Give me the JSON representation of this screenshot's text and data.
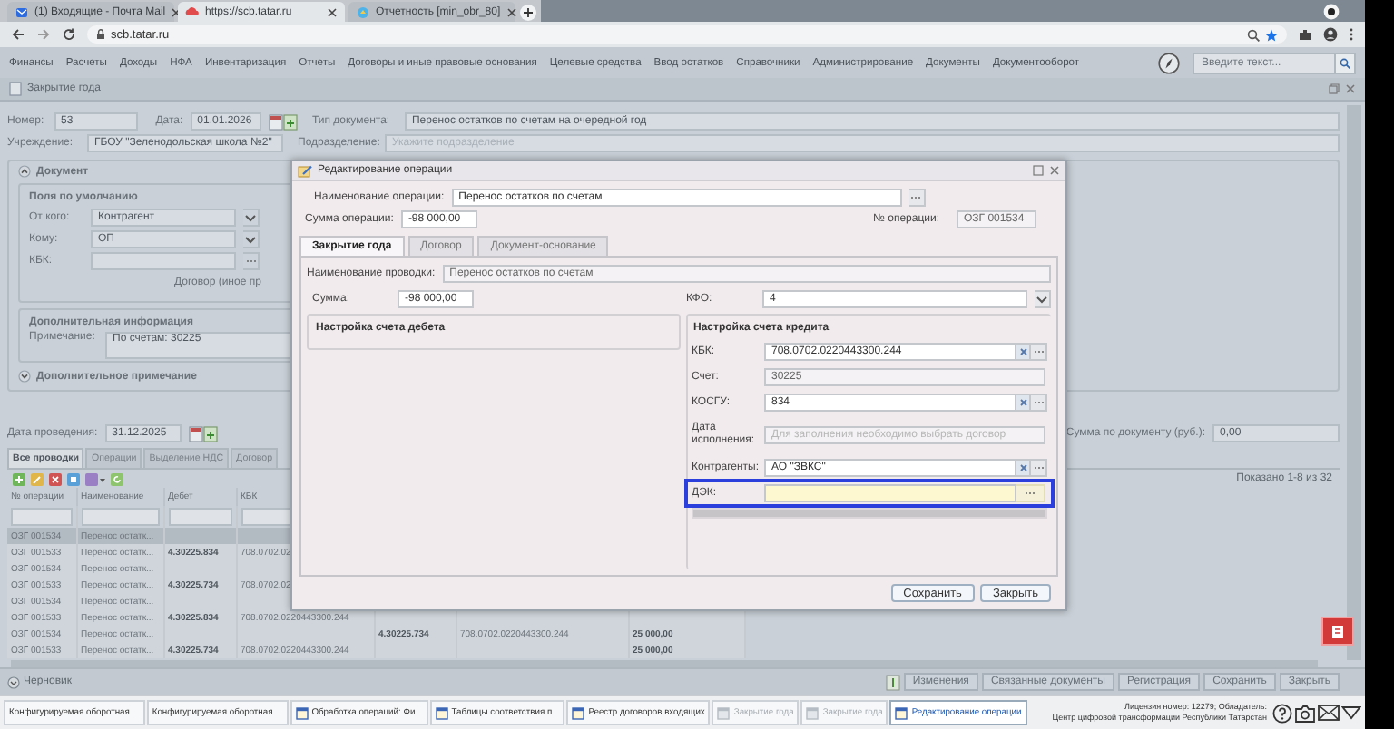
{
  "browser": {
    "tabs": [
      {
        "title": "(1) Входящие - Почта Mail",
        "selected": false
      },
      {
        "title": "https://scb.tatar.ru",
        "selected": true
      },
      {
        "title": "Отчетность [min_obr_80]",
        "selected": false
      }
    ],
    "address": "scb.tatar.ru"
  },
  "menu": [
    "Финансы",
    "Расчеты",
    "Доходы",
    "НФА",
    "Инвентаризация",
    "Отчеты",
    "Договоры и иные правовые основания",
    "Целевые средства",
    "Ввод остатков",
    "Справочники",
    "Администрирование",
    "Документы",
    "Документооборот"
  ],
  "search": {
    "placeholder": "Введите текст..."
  },
  "panel": {
    "title": "Закрытие года"
  },
  "form": {
    "number_label": "Номер:",
    "number": "53",
    "date_label": "Дата:",
    "date": "01.01.2026",
    "doc_type_label": "Тип документа:",
    "doc_type": "Перенос остатков по счетам на очередной год",
    "institution_label": "Учреждение:",
    "institution": "ГБОУ \"Зеленодольская школа №2\"",
    "division_label": "Подразделение:",
    "division_placeholder": "Укажите подразделение"
  },
  "document_section": {
    "title": "Документ",
    "expanded": true,
    "defaults_title": "Поля по умолчанию",
    "fields": [
      {
        "label": "От кого:",
        "value": "Контрагент",
        "kind": "select"
      },
      {
        "label": "Кому:",
        "value": "ОП",
        "kind": "select"
      },
      {
        "label": "КБК:",
        "kind": "lookup"
      }
    ],
    "contract_label": "Договор (иное пр",
    "extra_title": "Дополнительная информация",
    "note_label": "Примечание:",
    "note": "По счетам: 30225"
  },
  "extra_note": {
    "title": "Дополнительное примечание",
    "expanded": false
  },
  "posting_date": {
    "label": "Дата проведения:",
    "value": "31.12.2025"
  },
  "doc_sum": {
    "label": "Сумма по документу (руб.):",
    "value": "0,00"
  },
  "tabs": [
    {
      "label": "Все проводки",
      "selected": true
    },
    {
      "label": "Операции",
      "selected": false
    },
    {
      "label": "Выделение НДС",
      "selected": false
    },
    {
      "label": "Договор",
      "selected": false
    }
  ],
  "pager": "Показано 1-8 из 32",
  "table": {
    "columns": [
      "№ операции",
      "Наименование",
      "Дебет",
      "КБК"
    ],
    "rows": [
      {
        "op": "ОЗГ 001534",
        "name": "Перенос остатк...",
        "selected": true
      },
      {
        "op": "ОЗГ 001533",
        "name": "Перенос остатк...",
        "debit": "4.30225.834",
        "kbk": "708.0702.02",
        "selected": false
      },
      {
        "op": "ОЗГ 001534",
        "name": "Перенос остатк...",
        "selected": false
      },
      {
        "op": "ОЗГ 001533",
        "name": "Перенос остатк...",
        "debit": "4.30225.734",
        "kbk": "708.0702.02",
        "selected": false
      },
      {
        "op": "ОЗГ 001534",
        "name": "Перенос остатк...",
        "selected": false
      },
      {
        "op": "ОЗГ 001533",
        "name": "Перенос остатк...",
        "debit": "4.30225.834",
        "kbk": "708.0702.0220443300.244",
        "selected": false
      },
      {
        "op": "ОЗГ 001534",
        "name": "Перенос остатк...",
        "column_5": "4.30225.734",
        "column_6": "708.0702.0220443300.244",
        "column_7": "25 000,00",
        "selected": false
      },
      {
        "op": "ОЗГ 001533",
        "name": "Перенос остатк...",
        "debit": "4.30225.734",
        "kbk": "708.0702.0220443300.244",
        "column_7": "25 000,00",
        "selected": false
      }
    ]
  },
  "dialog": {
    "title": "Редактирование операции",
    "op_name_label": "Наименование операции:",
    "op_name": "Перенос остатков по счетам",
    "op_sum_label": "Сумма операции:",
    "op_sum": "-98 000,00",
    "op_no_label": "№ операции:",
    "op_no": "ОЗГ 001534",
    "tabs": [
      {
        "label": "Закрытие года",
        "selected": true
      },
      {
        "label": "Договор",
        "selected": false
      },
      {
        "label": "Документ-основание",
        "selected": false
      }
    ],
    "posting_name_label": "Наименование проводки:",
    "posting_name": "Перенос остатков по счетам",
    "sum_label": "Сумма:",
    "sum": "-98 000,00",
    "kfo_label": "КФО:",
    "kfo": "4",
    "debit_title": "Настройка счета дебета",
    "credit_title": "Настройка счета кредита",
    "credit_fields": [
      {
        "label": "КБК:",
        "value": "708.0702.0220443300.244",
        "kind": "lookup",
        "highlighted": false
      },
      {
        "label": "Счет:",
        "value": "30225",
        "kind": "readonly",
        "highlighted": false
      },
      {
        "label": "КОСГУ:",
        "value": "834",
        "kind": "lookup",
        "highlighted": false
      },
      {
        "label": "Дата исполнения:",
        "placeholder": "Для заполнения необходимо выбрать договор",
        "kind": "readonly",
        "highlighted": false
      },
      {
        "label": "Контрагенты:",
        "value": "АО \"ЗВКС\"",
        "kind": "lookup",
        "highlighted": false
      },
      {
        "label": "ДЭК:",
        "kind": "picker",
        "highlighted": true
      }
    ],
    "buttons": [
      "Сохранить",
      "Закрыть"
    ]
  },
  "status": "Черновик",
  "actions": [
    "Изменения",
    "Связанные документы",
    "Регистрация",
    "Сохранить",
    "Закрыть"
  ],
  "taskbar": [
    {
      "title": "Конфигурируемая оборотная ...",
      "kind": "plain",
      "selected": false,
      "disabled": false
    },
    {
      "title": "Конфигурируемая оборотная ...",
      "kind": "plain",
      "selected": false,
      "disabled": false
    },
    {
      "title": "Обработка операций: Фи...",
      "kind": "window",
      "selected": false,
      "disabled": false
    },
    {
      "title": "Таблицы соответствия п...",
      "kind": "window",
      "selected": false,
      "disabled": false
    },
    {
      "title": "Реестр договоров входящих",
      "kind": "window",
      "selected": false,
      "disabled": false
    },
    {
      "title": "Закрытие года",
      "kind": "window",
      "selected": false,
      "disabled": true
    },
    {
      "title": "Закрытие года",
      "kind": "window",
      "selected": false,
      "disabled": true
    },
    {
      "title": "Редактирование операции",
      "kind": "window",
      "selected": true,
      "disabled": false
    }
  ],
  "license": [
    "Лицензия номер: 12279; Обладатель:",
    "Центр цифровой трансформации Республики Татарстан"
  ]
}
